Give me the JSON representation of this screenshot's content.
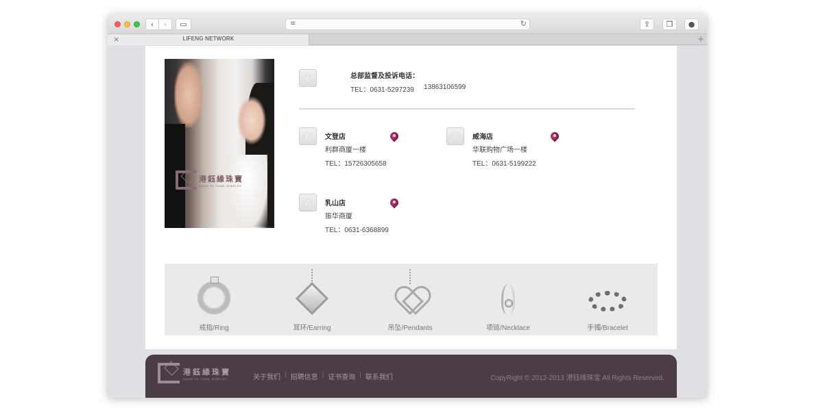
{
  "browser": {
    "tab_title": "LIFENG NETWORK",
    "tab_close": "×",
    "new_tab": "+",
    "back_icon": "chevron-left",
    "forward_icon": "chevron-right",
    "reader_icon": "≡",
    "reload_icon": "↻"
  },
  "photo": {
    "logo_cn": "港鈺緣珠寶",
    "logo_en": "GANG YU YUAN JEWELRY"
  },
  "headquarters": {
    "title": "总部监督及投诉电话：",
    "tel": "TEL：0631-5297239",
    "mobile": "13863106599"
  },
  "stores": [
    {
      "name": "文登店",
      "address": "利群商厦一楼",
      "tel": "TEL：15726305658"
    },
    {
      "name": "威海店",
      "address": "华联购物广场一楼",
      "tel": "TEL：0631-5199222"
    },
    {
      "name": "乳山店",
      "address": "振华商厦",
      "tel": "TEL：0631-6368899"
    }
  ],
  "products": [
    {
      "label": "戒指/Ring",
      "icon": "ring-icon"
    },
    {
      "label": "耳环/Earring",
      "icon": "earring-icon"
    },
    {
      "label": "吊坠/Pendants",
      "icon": "pendant-icon"
    },
    {
      "label": "项链/Necklace",
      "icon": "necklace-icon"
    },
    {
      "label": "手镯/Bracelet",
      "icon": "bracelet-icon"
    }
  ],
  "footer": {
    "logo_cn": "港鈺緣珠寶",
    "logo_en": "GANG YU YUAN JEWELRY",
    "links": [
      "关于我们",
      "招聘信息",
      "证书查询",
      "联系我们"
    ],
    "separator": "|",
    "copyright": "CopyRight © 2012-2013 港钰缘珠宝 All Rights Reserved."
  },
  "colors": {
    "footer_bg": "#4b3d45",
    "pin": "#8b1f52",
    "panel_bg": "#ebeaeb"
  }
}
